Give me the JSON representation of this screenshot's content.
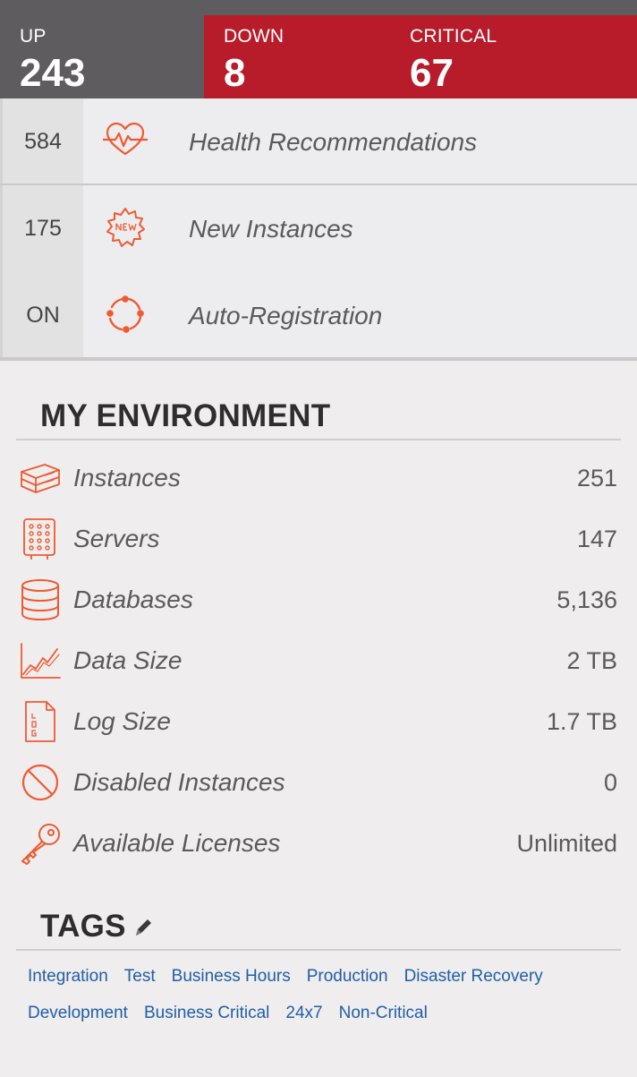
{
  "status": {
    "up": {
      "label": "UP",
      "value": "243"
    },
    "down": {
      "label": "DOWN",
      "value": "8"
    },
    "critical": {
      "label": "CRITICAL",
      "value": "67"
    }
  },
  "summary": [
    {
      "count": "584",
      "label": "Health Recommendations",
      "icon": "heartbeat-icon"
    },
    {
      "count": "175",
      "label": "New Instances",
      "icon": "new-badge-icon"
    },
    {
      "count": "ON",
      "label": "Auto-Registration",
      "icon": "refresh-cycle-icon"
    }
  ],
  "environment": {
    "title": "MY ENVIRONMENT",
    "items": [
      {
        "label": "Instances",
        "value": "251",
        "icon": "server-box-icon"
      },
      {
        "label": "Servers",
        "value": "147",
        "icon": "server-rack-icon"
      },
      {
        "label": "Databases",
        "value": "5,136",
        "icon": "database-icon"
      },
      {
        "label": "Data Size",
        "value": "2 TB",
        "icon": "line-chart-icon"
      },
      {
        "label": "Log Size",
        "value": "1.7 TB",
        "icon": "log-file-icon"
      },
      {
        "label": "Disabled Instances",
        "value": "0",
        "icon": "disabled-icon"
      },
      {
        "label": "Available Licenses",
        "value": "Unlimited",
        "icon": "key-icon"
      }
    ]
  },
  "tags": {
    "title": "TAGS",
    "edit_icon": "pencil-icon",
    "items": [
      "Integration",
      "Test",
      "Business Hours",
      "Production",
      "Disaster Recovery",
      "Development",
      "Business Critical",
      "24x7",
      "Non-Critical"
    ]
  },
  "colors": {
    "up_bg": "#5e5c5f",
    "alert_bg": "#b81c2a",
    "accent_icon": "#f05a32",
    "tag_link": "#1f5fa8"
  }
}
